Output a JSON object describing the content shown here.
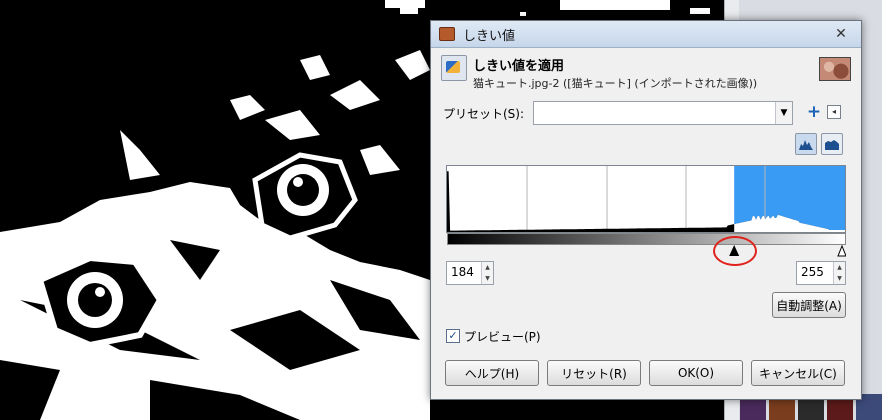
{
  "dialog": {
    "window_title": "しきい値",
    "close_symbol": "✕",
    "operation_title": "しきい値を適用",
    "image_subtitle": "猫キュート.jpg-2 ([猫キュート] (インポートされた画像))"
  },
  "presets": {
    "label": "プリセット(S):",
    "value": "",
    "add_symbol": "+",
    "menu_symbol": "◂"
  },
  "histogram": {
    "scale": "linear",
    "channel_min": 0,
    "channel_max": 255,
    "selection_color": "#3a9bf4",
    "threshold_low": 184,
    "threshold_high": 255
  },
  "low_value": "184",
  "high_value": "255",
  "buttons": {
    "auto": "自動調整(A)",
    "help": "ヘルプ(H)",
    "reset": "リセット(R)",
    "ok": "OK(O)",
    "cancel": "キャンセル(C)"
  },
  "preview": {
    "checked": true,
    "check_symbol": "✓",
    "label": "プレビュー(P)"
  },
  "colors": {
    "annotation": "#e0231c",
    "accent": "#3a9bf4"
  }
}
